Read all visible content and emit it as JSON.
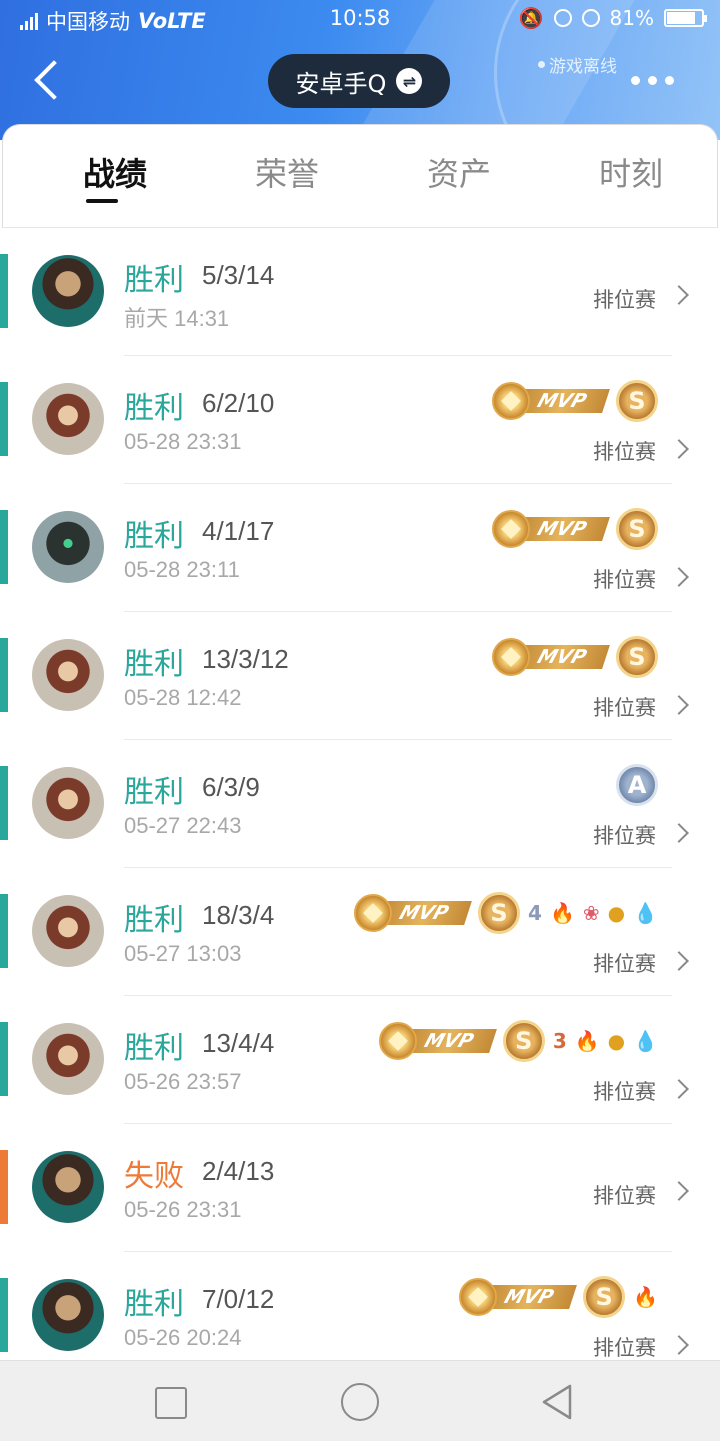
{
  "status": {
    "carrier": "中国移动",
    "volte": "VoLTE",
    "network": "4G",
    "time": "10:58",
    "battery": "81%",
    "battery_level": 0.81
  },
  "header": {
    "account_name": "安卓手Q",
    "swap_icon": "⇌",
    "offline_label": "游戏离线"
  },
  "tabs": [
    {
      "label": "战绩",
      "active": true
    },
    {
      "label": "荣誉",
      "active": false
    },
    {
      "label": "资产",
      "active": false
    },
    {
      "label": "时刻",
      "active": false
    }
  ],
  "colors": {
    "win": "#2aa79b",
    "loss": "#ee7a37",
    "header_blue": "#3c8bf0"
  },
  "matches": [
    {
      "result": "胜利",
      "outcome": "win",
      "kda": "5/3/14",
      "time": "前天 14:31",
      "mode": "排位赛",
      "mvp": false,
      "medal": null,
      "extras": [],
      "hero": "hero-a"
    },
    {
      "result": "胜利",
      "outcome": "win",
      "kda": "6/2/10",
      "time": "05-28 23:31",
      "mode": "排位赛",
      "mvp": true,
      "mvp_label": "MVP",
      "medal": "S",
      "extras": [],
      "hero": "hero-b"
    },
    {
      "result": "胜利",
      "outcome": "win",
      "kda": "4/1/17",
      "time": "05-28 23:11",
      "mode": "排位赛",
      "mvp": true,
      "mvp_label": "MVP",
      "medal": "S",
      "extras": [],
      "hero": "hero-c"
    },
    {
      "result": "胜利",
      "outcome": "win",
      "kda": "13/3/12",
      "time": "05-28 12:42",
      "mode": "排位赛",
      "mvp": true,
      "mvp_label": "MVP",
      "medal": "S",
      "extras": [],
      "hero": "hero-b"
    },
    {
      "result": "胜利",
      "outcome": "win",
      "kda": "6/3/9",
      "time": "05-27 22:43",
      "mode": "排位赛",
      "mvp": false,
      "medal": "A",
      "extras": [],
      "hero": "hero-b"
    },
    {
      "result": "胜利",
      "outcome": "win",
      "kda": "18/3/4",
      "time": "05-27 13:03",
      "mode": "排位赛",
      "mvp": true,
      "mvp_label": "MVP",
      "medal": "S",
      "extras": [
        "4",
        "fire",
        "lotus",
        "coin",
        "drop"
      ],
      "hero": "hero-b"
    },
    {
      "result": "胜利",
      "outcome": "win",
      "kda": "13/4/4",
      "time": "05-26 23:57",
      "mode": "排位赛",
      "mvp": true,
      "mvp_label": "MVP",
      "medal": "S",
      "extras": [
        "3",
        "fire",
        "coin",
        "drop"
      ],
      "hero": "hero-b"
    },
    {
      "result": "失败",
      "outcome": "loss",
      "kda": "2/4/13",
      "time": "05-26 23:31",
      "mode": "排位赛",
      "mvp": false,
      "medal": null,
      "extras": [],
      "hero": "hero-a"
    },
    {
      "result": "胜利",
      "outcome": "win",
      "kda": "7/0/12",
      "time": "05-26 20:24",
      "mode": "排位赛",
      "mvp": true,
      "mvp_label": "MVP",
      "medal": "S",
      "extras": [
        "fire"
      ],
      "hero": "hero-a"
    }
  ],
  "navbar": {
    "items": [
      "recent-apps",
      "home",
      "back"
    ]
  }
}
